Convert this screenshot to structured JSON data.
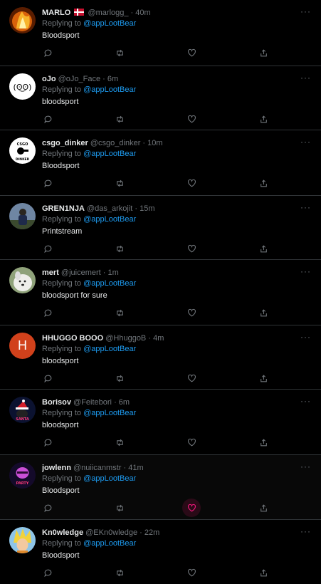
{
  "tweets": [
    {
      "name": "MARLO",
      "flag": true,
      "handle": "@marlogg_",
      "time": "40m",
      "replying_label": "Replying to",
      "mention": "@appLootBear",
      "text": "Bloodsport",
      "avatar": "fire-avatar"
    },
    {
      "name": "oJo",
      "flag": false,
      "handle": "@oJo_Face",
      "time": "6m",
      "replying_label": "Replying to",
      "mention": "@appLootBear",
      "text": "bloodsport",
      "avatar": "face-avatar"
    },
    {
      "name": "csgo_dinker",
      "flag": false,
      "handle": "@csgo_dinker",
      "time": "10m",
      "replying_label": "Replying to",
      "mention": "@appLootBear",
      "text": "Bloodsport",
      "avatar": "logo-avatar"
    },
    {
      "name": "GREN1NJA",
      "flag": false,
      "handle": "@das_arkojit",
      "time": "15m",
      "replying_label": "Replying to",
      "mention": "@appLootBear",
      "text": "Printstream",
      "avatar": "person-avatar"
    },
    {
      "name": "mert",
      "flag": false,
      "handle": "@juicemert",
      "time": "1m",
      "replying_label": "Replying to",
      "mention": "@appLootBear",
      "text": "bloodsport for sure",
      "avatar": "dog-avatar"
    },
    {
      "name": "HHUGGO BOOO",
      "flag": false,
      "handle": "@HhuggoB",
      "time": "4m",
      "replying_label": "Replying to",
      "mention": "@appLootBear",
      "text": "bloodsport",
      "avatar": "letter-avatar",
      "avatar_letter": "H"
    },
    {
      "name": "Borisov",
      "flag": false,
      "handle": "@Feitebori",
      "time": "6m",
      "replying_label": "Replying to",
      "mention": "@appLootBear",
      "text": "bloodsport",
      "avatar": "santa-avatar"
    },
    {
      "name": "jowlenn",
      "flag": false,
      "handle": "@nuiicanmstr",
      "time": "41m",
      "replying_label": "Replying to",
      "mention": "@appLootBear",
      "text": "Bloodsport",
      "avatar": "mask-avatar"
    },
    {
      "name": "Kn0wledge",
      "flag": false,
      "handle": "@EKn0wledge",
      "time": "22m",
      "replying_label": "Replying to",
      "mention": "@appLootBear",
      "text": "Bloodsport",
      "avatar": "anime-avatar"
    }
  ],
  "colors": {
    "accent": "#1d9bf0",
    "muted": "#71767b",
    "like_active": "#f91880"
  },
  "icons": [
    "more-icon",
    "reply-icon",
    "retweet-icon",
    "like-icon",
    "share-icon"
  ]
}
